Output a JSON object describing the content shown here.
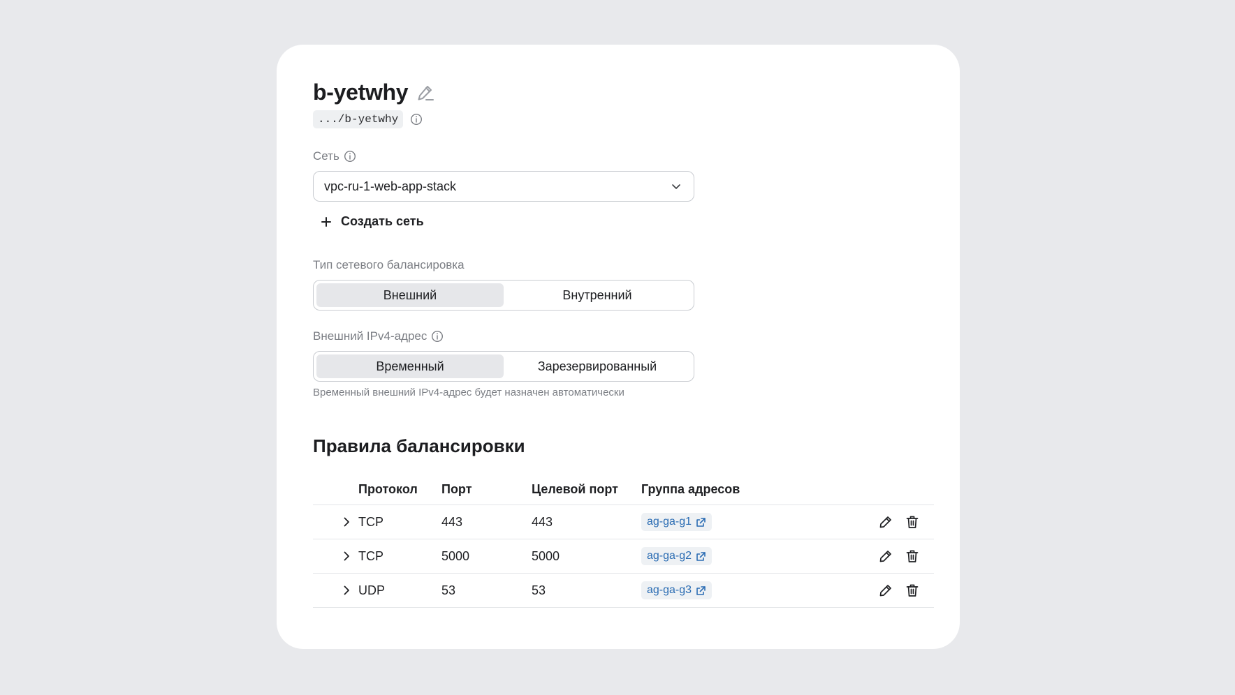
{
  "balancer": {
    "name": "b-yetwhy",
    "path": ".../b-yetwhy"
  },
  "network": {
    "label": "Сеть",
    "selected": "vpc-ru-1-web-app-stack",
    "create_label": "Создать сеть"
  },
  "balancer_type": {
    "label": "Тип сетевого балансировка",
    "options": [
      "Внешний",
      "Внутренний"
    ],
    "selected": "Внешний"
  },
  "ipv4": {
    "label": "Внешний IPv4-адрес",
    "options": [
      "Временный",
      "Зарезервированный"
    ],
    "selected": "Временный",
    "hint": "Временный внешний IPv4-адрес будет назначен автоматически"
  },
  "rules": {
    "title": "Правила балансировки",
    "columns": [
      "Протокол",
      "Порт",
      "Целевой порт",
      "Группа адресов"
    ],
    "rows": [
      {
        "protocol": "TCP",
        "port": "443",
        "target_port": "443",
        "group": "ag-ga-g1"
      },
      {
        "protocol": "TCP",
        "port": "5000",
        "target_port": "5000",
        "group": "ag-ga-g2"
      },
      {
        "protocol": "UDP",
        "port": "53",
        "target_port": "53",
        "group": "ag-ga-g3"
      }
    ]
  },
  "icons": {
    "edit_title": "pencil-edit-icon",
    "info": "info-icon",
    "dropdown": "chevron-down-icon",
    "add": "plus-icon",
    "expand": "chevron-right-icon",
    "external_link": "external-link-icon",
    "edit_row": "pencil-icon",
    "delete_row": "trash-icon"
  },
  "colors": {
    "background": "#e8e9ec",
    "card": "#ffffff",
    "link": "#2a6cb3",
    "segment_active": "#e6e7ea"
  }
}
